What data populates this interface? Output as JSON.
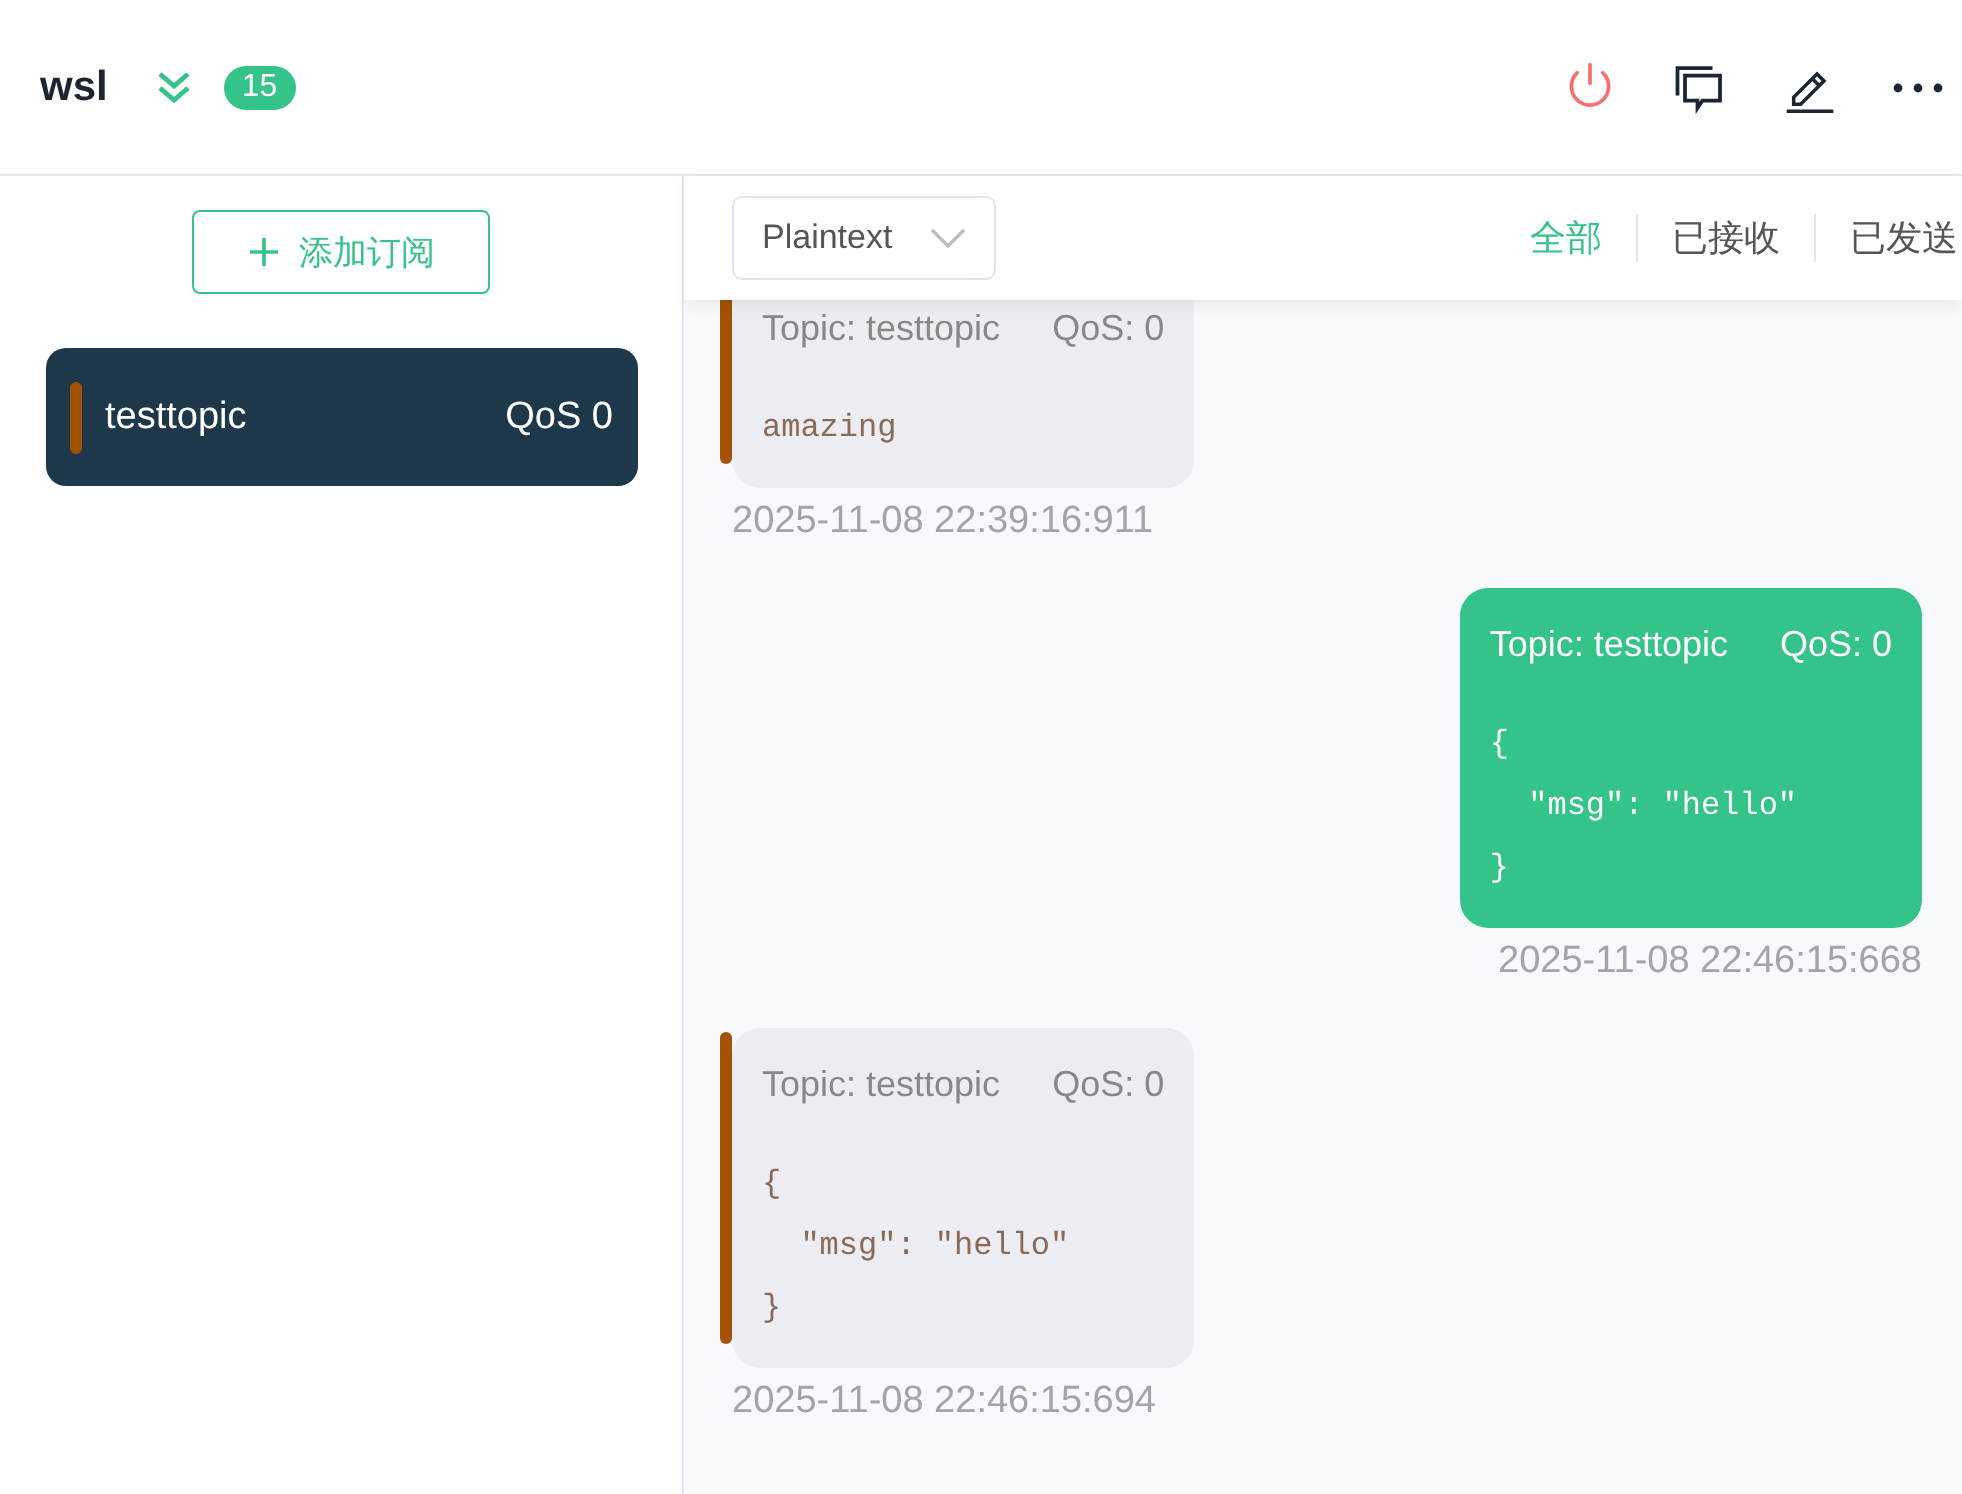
{
  "header": {
    "title": "wsl",
    "badge": "15"
  },
  "sidebar": {
    "add_button": "添加订阅",
    "subscriptions": [
      {
        "topic": "testtopic",
        "qos": "QoS 0",
        "color": "#a35200",
        "selected": true
      }
    ]
  },
  "toolbar": {
    "format": "Plaintext",
    "filters": [
      {
        "label": "全部",
        "selected": true
      },
      {
        "label": "已接收",
        "selected": false
      },
      {
        "label": "已发送",
        "selected": false
      }
    ]
  },
  "messages": [
    {
      "kind": "received",
      "topic": "Topic: testtopic",
      "qos": "QoS: 0",
      "payload": "amazing",
      "time": "2025-11-08 22:39:16:911",
      "color": "#a35200"
    },
    {
      "kind": "sent",
      "topic": "Topic: testtopic",
      "qos": "QoS: 0",
      "payload": "{\n  \"msg\": \"hello\"\n}",
      "time": "2025-11-08 22:46:15:668"
    },
    {
      "kind": "received",
      "topic": "Topic: testtopic",
      "qos": "QoS: 0",
      "payload": "{\n  \"msg\": \"hello\"\n}",
      "time": "2025-11-08 22:46:15:694",
      "color": "#a35200"
    }
  ]
}
